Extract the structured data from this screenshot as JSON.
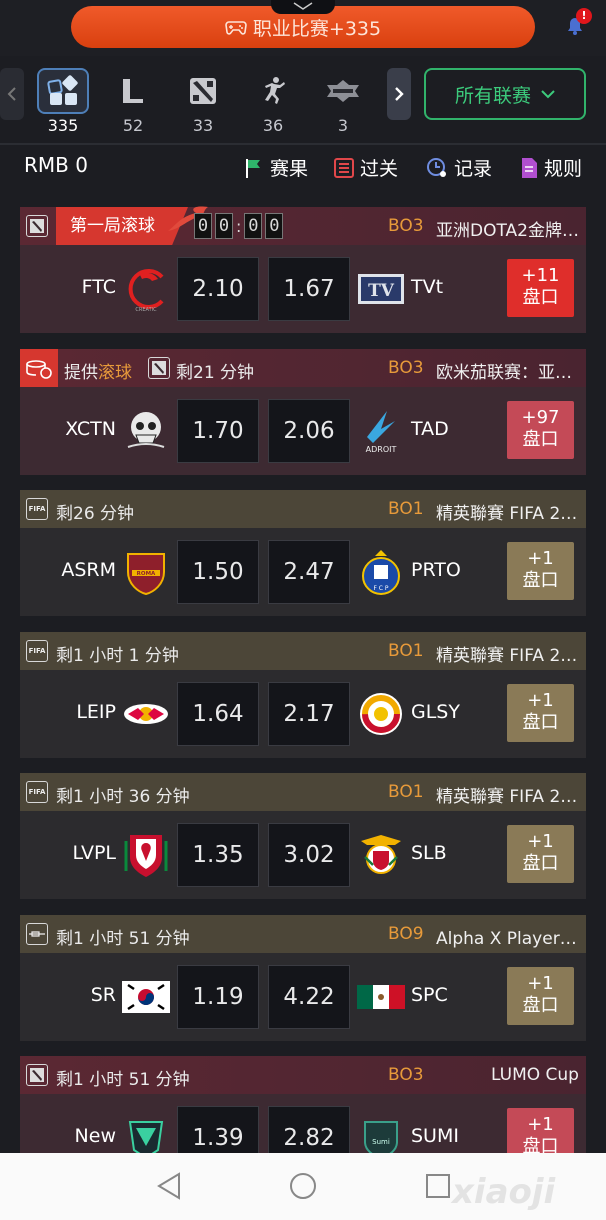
{
  "topbar": {
    "pro_match_label": "职业比赛+335",
    "notif_badge": "!"
  },
  "games": [
    {
      "name": "all-games",
      "count": "335",
      "active": true
    },
    {
      "name": "lol",
      "count": "52"
    },
    {
      "name": "dota2",
      "count": "33"
    },
    {
      "name": "csgo",
      "count": "36"
    },
    {
      "name": "kog",
      "count": "3"
    }
  ],
  "league_filter": {
    "label": "所有联赛"
  },
  "info": {
    "balance": "RMB 0",
    "results": "赛果",
    "parlay": "过关",
    "records": "记录",
    "rules": "规则"
  },
  "matches": [
    {
      "game": "DOTA",
      "header_type": "live",
      "live_label": "第一局滚球",
      "clock": [
        "0",
        "0",
        "0",
        "0"
      ],
      "bo": "BO3",
      "league": "亚洲DOTA2金牌…",
      "home": "FTC",
      "away": "TVt",
      "odd_home": "2.10",
      "odd_away": "1.67",
      "more_count": "+11",
      "more_label": "盘口",
      "theme": "red"
    },
    {
      "game": "DOTA",
      "header_type": "rolling",
      "rolling_prefix": "提供",
      "rolling_hl": "滚球",
      "status": "剩21 分钟",
      "bo": "BO3",
      "league": "欧米茄联赛：亚…",
      "home": "XCTN",
      "away": "TAD",
      "odd_home": "1.70",
      "odd_away": "2.06",
      "more_count": "+97",
      "more_label": "盘口",
      "theme": "red2"
    },
    {
      "game": "FIFA",
      "header_type": "normal",
      "status": "剩26 分钟",
      "bo": "BO1",
      "league": "精英聯賽 FIFA 2…",
      "home": "ASRM",
      "away": "PRTO",
      "odd_home": "1.50",
      "odd_away": "2.47",
      "more_count": "+1",
      "more_label": "盘口",
      "theme": "olive"
    },
    {
      "game": "FIFA",
      "header_type": "normal",
      "status": "剩1 小时 1 分钟",
      "bo": "BO1",
      "league": "精英聯賽 FIFA 2…",
      "home": "LEIP",
      "away": "GLSY",
      "odd_home": "1.64",
      "odd_away": "2.17",
      "more_count": "+1",
      "more_label": "盘口",
      "theme": "olive"
    },
    {
      "game": "FIFA",
      "header_type": "normal",
      "status": "剩1 小时 36 分钟",
      "bo": "BO1",
      "league": "精英聯賽 FIFA 2…",
      "home": "LVPL",
      "away": "SLB",
      "odd_home": "1.35",
      "odd_away": "3.02",
      "more_count": "+1",
      "more_label": "盘口",
      "theme": "olive"
    },
    {
      "game": "PUBG",
      "header_type": "normal",
      "status": "剩1 小时 51 分钟",
      "bo": "BO9",
      "league": "Alpha X Player邀…",
      "home": "SR",
      "away": "SPC",
      "odd_home": "1.19",
      "odd_away": "4.22",
      "more_count": "+1",
      "more_label": "盘口",
      "theme": "olive"
    },
    {
      "game": "DOTA",
      "header_type": "normal",
      "status": "剩1 小时 51 分钟",
      "bo": "BO3",
      "league": "LUMO Cup",
      "home": "New",
      "away": "SUMI",
      "odd_home": "1.39",
      "odd_away": "2.82",
      "more_count": "+1",
      "more_label": "盘口",
      "theme": "red2"
    }
  ],
  "colors": {
    "accent_green": "#3ccb7c",
    "live_red": "#d6372f",
    "bo_orange": "#e79a3a"
  }
}
